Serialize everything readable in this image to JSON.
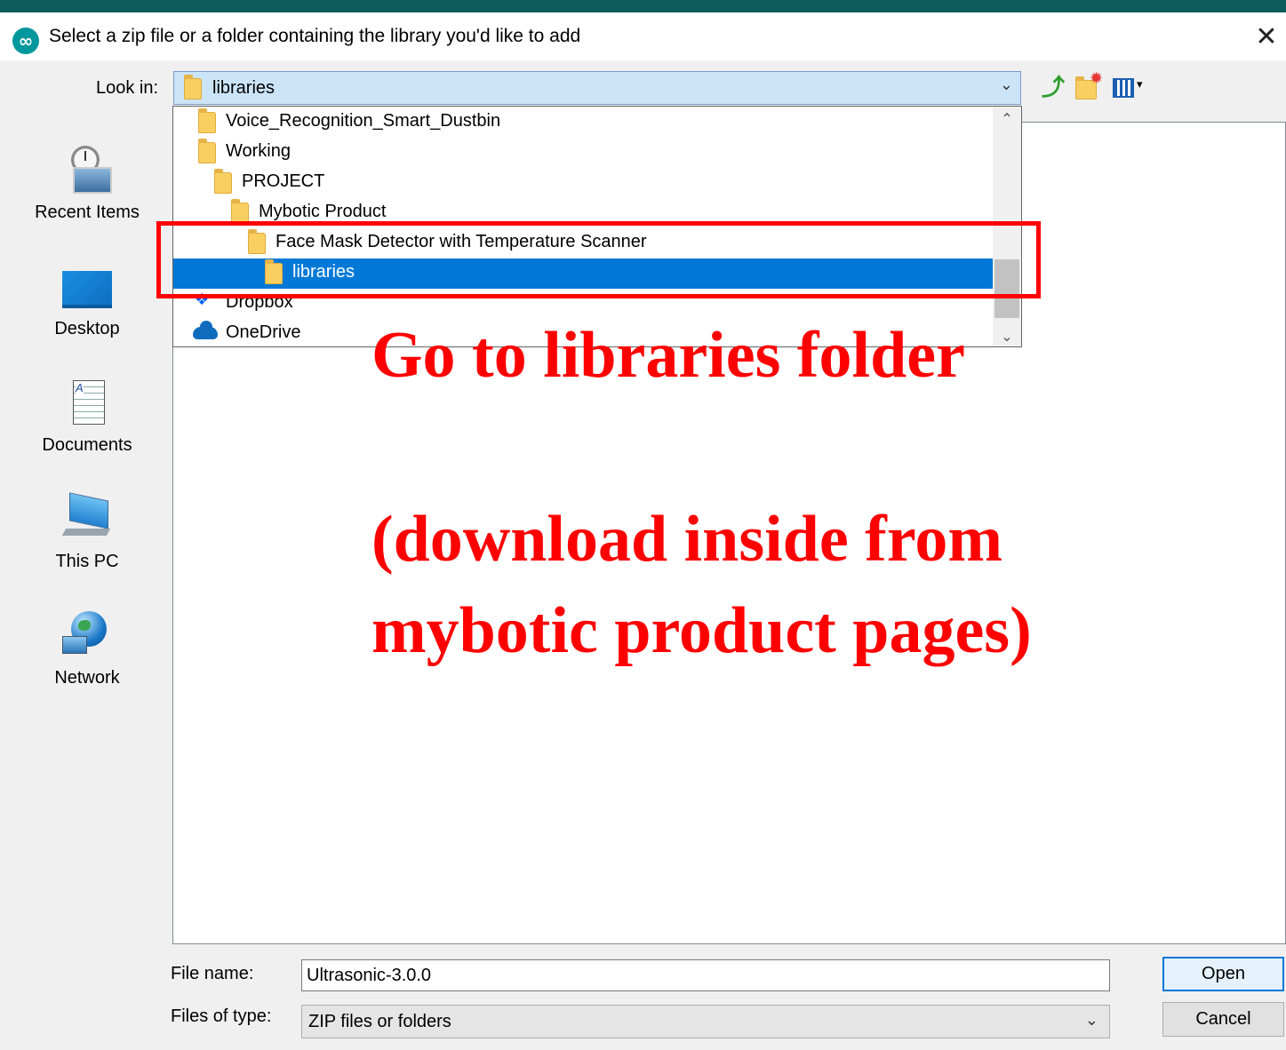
{
  "window": {
    "title": "Select a zip file or a folder containing the library you'd like to add",
    "close_glyph": "✕"
  },
  "look_in": {
    "label": "Look in:",
    "value": "libraries",
    "chevron": "⌄"
  },
  "toolbar": {
    "up_icon": "up-one-level-icon",
    "new_folder_icon": "new-folder-icon",
    "view_menu_icon": "view-menu-icon",
    "view_arrow": "▾"
  },
  "places": [
    {
      "label": "Recent Items",
      "icon": "recent-items-icon"
    },
    {
      "label": "Desktop",
      "icon": "desktop-icon"
    },
    {
      "label": "Documents",
      "icon": "documents-icon"
    },
    {
      "label": "This PC",
      "icon": "this-pc-icon"
    },
    {
      "label": "Network",
      "icon": "network-icon"
    }
  ],
  "dropdown": {
    "items": [
      {
        "label": "Voice_Recognition_Smart_Dustbin",
        "icon": "folder-icon"
      },
      {
        "label": "Working",
        "icon": "folder-icon"
      },
      {
        "label": "PROJECT",
        "icon": "folder-icon"
      },
      {
        "label": "Mybotic Product",
        "icon": "folder-icon"
      },
      {
        "label": "Face Mask Detector with Temperature Scanner",
        "icon": "folder-icon"
      },
      {
        "label": "libraries",
        "icon": "folder-icon",
        "selected": true
      },
      {
        "label": "Dropbox",
        "icon": "dropbox-icon"
      },
      {
        "label": "OneDrive",
        "icon": "onedrive-icon"
      }
    ],
    "scroll_up": "⌃",
    "scroll_down": "⌄"
  },
  "annotation": {
    "line1": "Go to libraries folder",
    "line2": "(download inside from",
    "line3": "mybotic product pages)",
    "color": "#ff0000"
  },
  "file_name": {
    "label": "File name:",
    "value": "Ultrasonic-3.0.0"
  },
  "file_type": {
    "label": "Files of type:",
    "value": "ZIP files or folders",
    "chevron": "⌄"
  },
  "buttons": {
    "open": "Open",
    "cancel": "Cancel"
  },
  "colors": {
    "selection": "#0078d7",
    "title_strip": "#0c5b5d",
    "arduino_teal": "#00979d"
  }
}
